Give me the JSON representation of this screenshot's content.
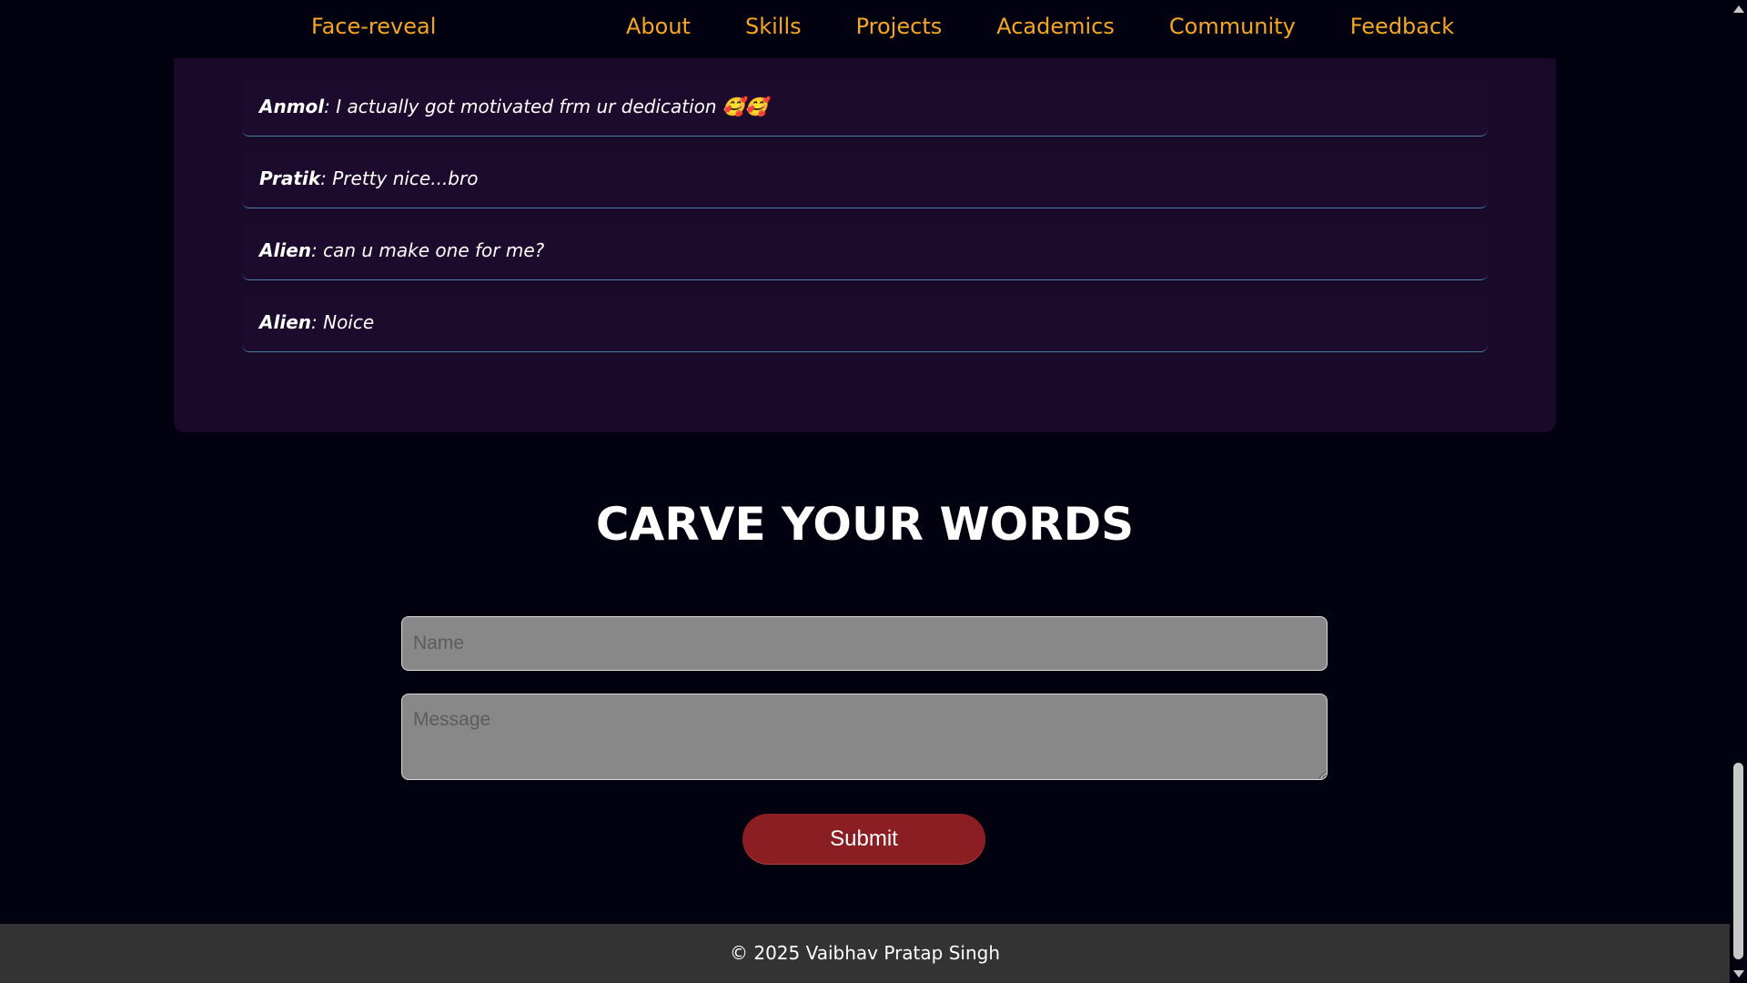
{
  "nav": {
    "brand": "Face-reveal",
    "links": [
      "About",
      "Skills",
      "Projects",
      "Academics",
      "Community",
      "Feedback"
    ]
  },
  "comments": [
    {
      "name": "Anmol",
      "sep": ":",
      "text": " I actually got motivated frm ur dedication 🥰🥰"
    },
    {
      "name": "Pratik",
      "sep": ":",
      "text": " Pretty nice...bro"
    },
    {
      "name": "Alien",
      "sep": ":",
      "text": " can u make one for me?"
    },
    {
      "name": "Alien",
      "sep": ":",
      "text": " Noice"
    }
  ],
  "form": {
    "title": "CARVE YOUR WORDS",
    "name_placeholder": "Name",
    "message_placeholder": "Message",
    "submit_label": "Submit"
  },
  "footer": {
    "text": "© 2025 Vaibhav Pratap Singh"
  },
  "colors": {
    "accent": "#f5a623",
    "submit": "#8b1e22",
    "panel": "#1a0a2a"
  }
}
